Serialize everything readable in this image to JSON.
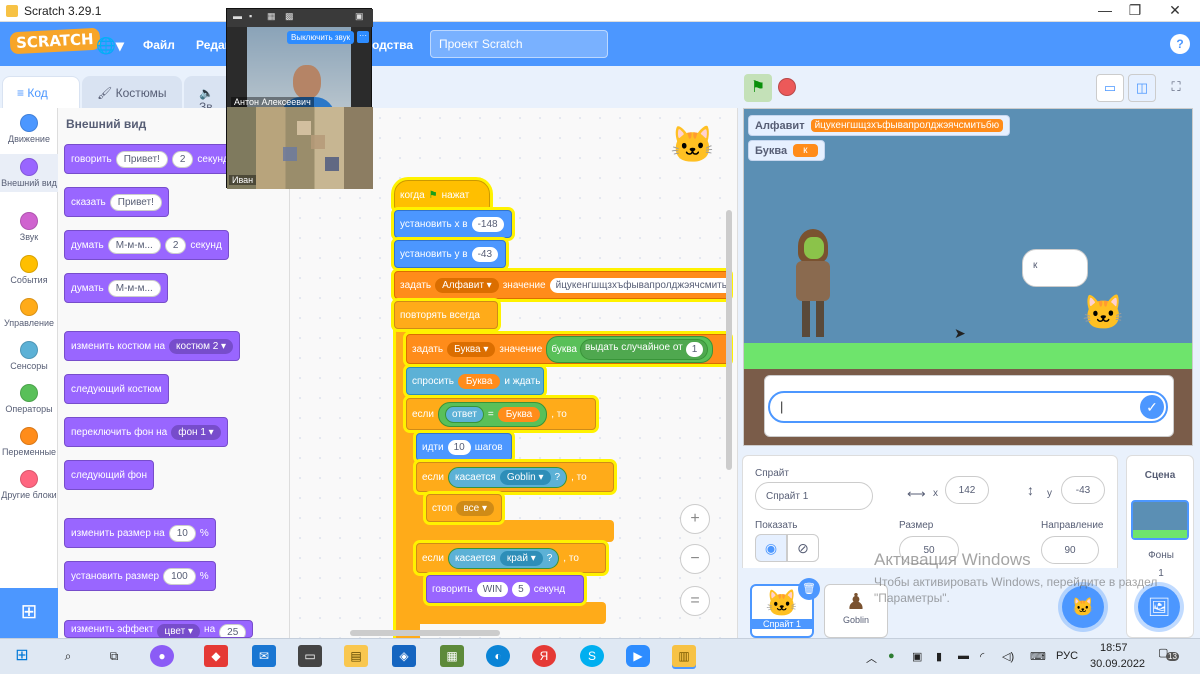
{
  "window": {
    "title": "Scratch 3.29.1",
    "minimize": "—",
    "maximize": "❐",
    "close": "✕"
  },
  "menubar": {
    "logo": "SCRATCH",
    "file": "Файл",
    "edit": "Редак",
    "tutorials": "одства",
    "project_title": "Проект Scratch",
    "help": "?"
  },
  "tabs": {
    "code": "Код",
    "costumes": "Костюмы",
    "sounds": "Зв"
  },
  "categories": [
    {
      "label": "Движение",
      "color": "#4c97ff"
    },
    {
      "label": "Внешний вид",
      "color": "#9966ff"
    },
    {
      "label": "Звук",
      "color": "#cf63cf"
    },
    {
      "label": "События",
      "color": "#ffbf00"
    },
    {
      "label": "Управление",
      "color": "#ffab19"
    },
    {
      "label": "Сенсоры",
      "color": "#5cb1d6"
    },
    {
      "label": "Операторы",
      "color": "#59c059"
    },
    {
      "label": "Переменные",
      "color": "#ff8c1a"
    },
    {
      "label": "Другие блоки",
      "color": "#ff6680"
    }
  ],
  "palette": {
    "heading": "Внешний вид",
    "say_for": {
      "label": "говорить",
      "text": "Привет!",
      "secs": "2",
      "unit": "секунд"
    },
    "say": {
      "label": "сказать",
      "text": "Привет!"
    },
    "think_for": {
      "label": "думать",
      "text": "М-м-м...",
      "secs": "2",
      "unit": "секунд"
    },
    "think": {
      "label": "думать",
      "text": "М-м-м..."
    },
    "switch_costume": {
      "label": "изменить костюм на",
      "value": "костюм 2"
    },
    "next_costume": "следующий костюм",
    "switch_backdrop": {
      "label": "переключить фон на",
      "value": "фон 1"
    },
    "next_backdrop": "следующий фон",
    "change_size": {
      "label": "изменить размер на",
      "value": "10",
      "unit": "%"
    },
    "set_size": {
      "label": "установить размер",
      "value": "100",
      "unit": "%"
    },
    "change_effect": {
      "label": "изменить эффект",
      "value": "цвет",
      "by": "на",
      "amount": "25"
    }
  },
  "script": {
    "hat": {
      "label": "когда",
      "after": "нажат"
    },
    "set_x": {
      "label": "установить х в",
      "value": "-148"
    },
    "set_y": {
      "label": "установить у в",
      "value": "-43"
    },
    "set_var1": {
      "label": "задать",
      "var": "Алфавит",
      "mid": "значение",
      "value": "йцукенгшщзхъфывапролджэячсмитьбю"
    },
    "forever": "повторять всегда",
    "set_var2": {
      "label": "задать",
      "var": "Буква",
      "mid": "значение",
      "letter": "буква",
      "random": "выдать случайное от",
      "from": "1"
    },
    "ask": {
      "label": "спросить",
      "var": "Буква",
      "after": "и ждать"
    },
    "if1": {
      "label": "если",
      "answer": "ответ",
      "eq": "=",
      "var": "Буква",
      "then": ", то"
    },
    "move": {
      "label": "идти",
      "steps": "10",
      "unit": "шагов"
    },
    "if2": {
      "label": "если",
      "touching": "касается",
      "target": "Goblin",
      "q": "?",
      "then": ", то"
    },
    "stop": {
      "label": "стоп",
      "value": "все"
    },
    "if3": {
      "label": "если",
      "touching": "касается",
      "target": "край",
      "q": "?",
      "then": ", то"
    },
    "say_win": {
      "label": "говорить",
      "text": "WIN",
      "secs": "5",
      "unit": "секунд"
    }
  },
  "zoom": {
    "in": "+",
    "out": "−",
    "reset": "="
  },
  "stage": {
    "monitor1": {
      "name": "Алфавит",
      "value": "йцукенгшщзхъфывапролджэячсмитьбю"
    },
    "monitor2": {
      "name": "Буква",
      "value": "к"
    },
    "speech": "к",
    "ask_input": "|"
  },
  "sprite_info": {
    "sprite_label": "Спрайт",
    "sprite_name": "Спрайт 1",
    "x_label": "x",
    "x": "142",
    "y_label": "у",
    "y": "-43",
    "show_label": "Показать",
    "size_label": "Размер",
    "size": "50",
    "direction_label": "Направление",
    "direction": "90"
  },
  "sprites": [
    {
      "name": "Спрайт 1"
    },
    {
      "name": "Goblin"
    }
  ],
  "stage_pane": {
    "title": "Сцена",
    "backdrops_label": "Фоны",
    "backdrops_count": "1"
  },
  "watermark": {
    "title": "Активация Windows",
    "text": "Чтобы активировать Windows, перейдите в раздел \"Параметры\"."
  },
  "video_call": {
    "mute_button": "Выключить звук",
    "participant1": "Антон Алексеевич",
    "participant2": "Иван"
  },
  "taskbar": {
    "language": "РУС",
    "time": "18:57",
    "date": "30.09.2022",
    "notifications": "13"
  },
  "colors": {
    "accent": "#4c97ff",
    "looks": "#9966ff",
    "events": "#ffbf00",
    "control": "#ffab19",
    "sensing": "#5cb1d6",
    "operators": "#59c059",
    "variables": "#ff8c1a"
  }
}
